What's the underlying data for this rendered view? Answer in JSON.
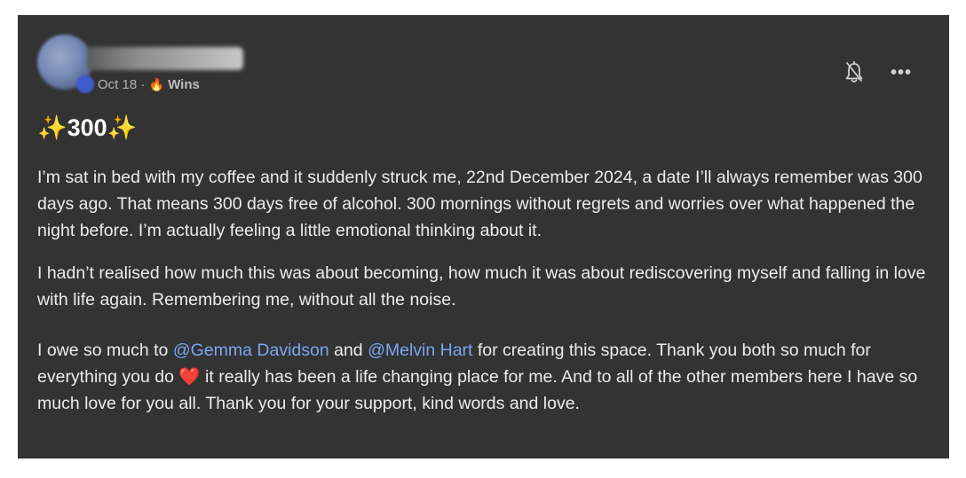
{
  "post": {
    "date": "Oct 18",
    "separator": "·",
    "category_emoji": "🔥",
    "category": "Wins",
    "title": "✨300✨",
    "paragraph_1": "I’m sat in bed with my coffee and it suddenly struck me, 22nd December 2024, a date I’ll always remember was 300 days ago. That means 300 days free of alcohol. 300 mornings without regrets and worries over what happened the night before. I’m actually feeling a little emotional thinking about it.",
    "paragraph_2": "I hadn’t realised how much this was about becoming, how much it was about rediscovering myself and falling in love with life again. Remembering me, without all the noise.",
    "paragraph_3": {
      "part_1": "I owe so much to ",
      "mention_1": "@Gemma Davidson",
      "part_2": " and ",
      "mention_2": "@Melvin Hart",
      "part_3": " for creating this space. Thank you both so much for everything you do ",
      "heart": "❤️",
      "part_4": " it really has been a life changing place for me. And to all of the other members here I have so much love for you all. Thank you for your support, kind words and love."
    }
  },
  "header_actions": {
    "bell_icon": "bell-off-icon",
    "more_label": "•••"
  },
  "colors": {
    "card_background": "#333333",
    "mention": "#7aa6f2",
    "heart": "#e8312e"
  }
}
